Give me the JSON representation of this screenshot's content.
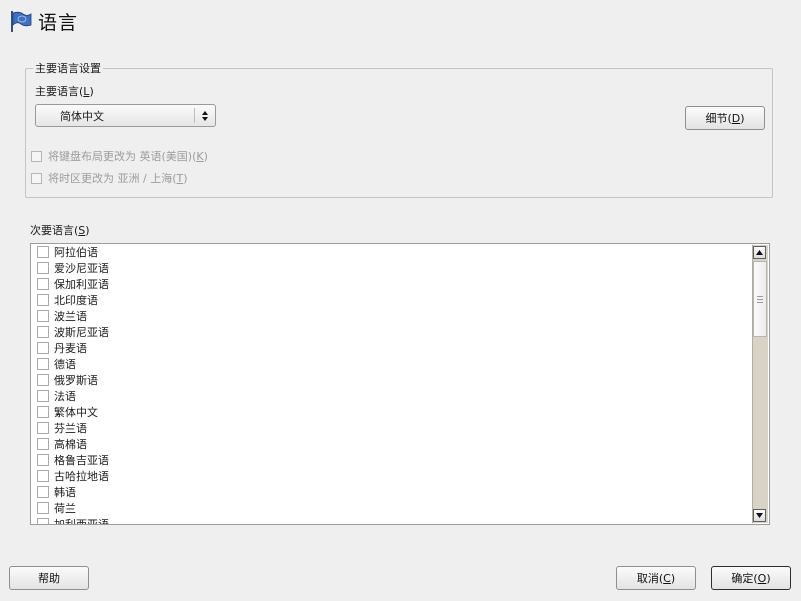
{
  "header": {
    "title": "语言",
    "icon": "flag-icon"
  },
  "primary_group": {
    "title": "主要语言设置",
    "primary_label": "主要语言",
    "primary_mnemonic": "L",
    "primary_value": "简体中文",
    "details_button": "细节",
    "details_mnemonic": "D",
    "keyboard_text": "将键盘布局更改为 英语(美国)",
    "keyboard_mnemonic": "K",
    "timezone_text": "将时区更改为 亚洲 / 上海",
    "timezone_mnemonic": "T"
  },
  "secondary": {
    "label": "次要语言",
    "mnemonic": "S",
    "languages": [
      "阿拉伯语",
      "爱沙尼亚语",
      "保加利亚语",
      "北印度语",
      "波兰语",
      "波斯尼亚语",
      "丹麦语",
      "德语",
      "俄罗斯语",
      "法语",
      "繁体中文",
      "芬兰语",
      "高棉语",
      "格鲁吉亚语",
      "古哈拉地语",
      "韩语",
      "荷兰",
      "加利西亚语"
    ]
  },
  "footer": {
    "help": "帮助",
    "cancel": "取消",
    "cancel_mnemonic": "C",
    "ok": "确定",
    "ok_mnemonic": "O"
  },
  "colors": {
    "background": "#efefef",
    "scrollbar_trough": "#d8d2c7",
    "disabled_text": "#9c9c9c"
  }
}
